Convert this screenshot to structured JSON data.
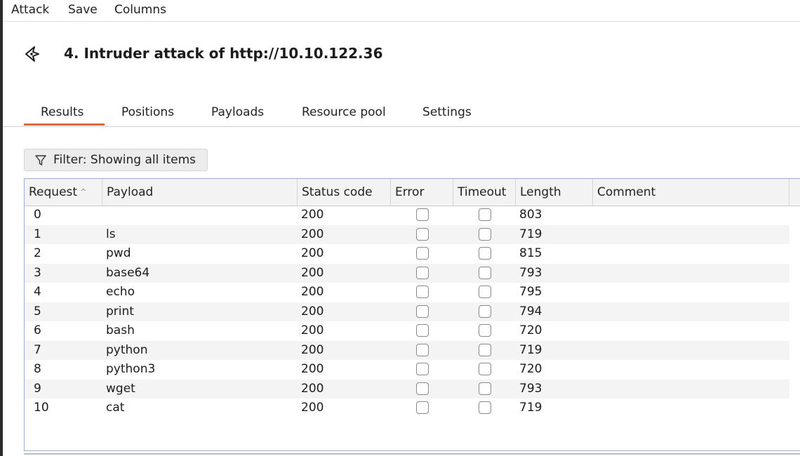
{
  "menu": [
    "Attack",
    "Save",
    "Columns"
  ],
  "title": "4. Intruder attack of http://10.10.122.36",
  "tabs": [
    "Results",
    "Positions",
    "Payloads",
    "Resource pool",
    "Settings"
  ],
  "active_tab": "Results",
  "filter_label": "Filter: Showing all items",
  "table": {
    "columns": [
      "Request",
      "Payload",
      "Status code",
      "Error",
      "Timeout",
      "Length",
      "Comment"
    ],
    "sort_column": "Request",
    "rows": [
      {
        "request": "0",
        "payload": "",
        "status": "200",
        "error": false,
        "timeout": false,
        "length": "803",
        "comment": ""
      },
      {
        "request": "1",
        "payload": "ls",
        "status": "200",
        "error": false,
        "timeout": false,
        "length": "719",
        "comment": ""
      },
      {
        "request": "2",
        "payload": "pwd",
        "status": "200",
        "error": false,
        "timeout": false,
        "length": "815",
        "comment": ""
      },
      {
        "request": "3",
        "payload": "base64",
        "status": "200",
        "error": false,
        "timeout": false,
        "length": "793",
        "comment": ""
      },
      {
        "request": "4",
        "payload": "echo",
        "status": "200",
        "error": false,
        "timeout": false,
        "length": "795",
        "comment": ""
      },
      {
        "request": "5",
        "payload": "print",
        "status": "200",
        "error": false,
        "timeout": false,
        "length": "794",
        "comment": ""
      },
      {
        "request": "6",
        "payload": "bash",
        "status": "200",
        "error": false,
        "timeout": false,
        "length": "720",
        "comment": ""
      },
      {
        "request": "7",
        "payload": "python",
        "status": "200",
        "error": false,
        "timeout": false,
        "length": "719",
        "comment": ""
      },
      {
        "request": "8",
        "payload": "python3",
        "status": "200",
        "error": false,
        "timeout": false,
        "length": "720",
        "comment": ""
      },
      {
        "request": "9",
        "payload": "wget",
        "status": "200",
        "error": false,
        "timeout": false,
        "length": "793",
        "comment": ""
      },
      {
        "request": "10",
        "payload": "cat",
        "status": "200",
        "error": false,
        "timeout": false,
        "length": "719",
        "comment": ""
      }
    ]
  },
  "colors": {
    "accent": "#e2673a",
    "row_alt": "#f4f4f4",
    "header_bg": "#f3f3f3"
  },
  "icons": {
    "title": "intruder-icon",
    "filter": "filter-icon"
  }
}
